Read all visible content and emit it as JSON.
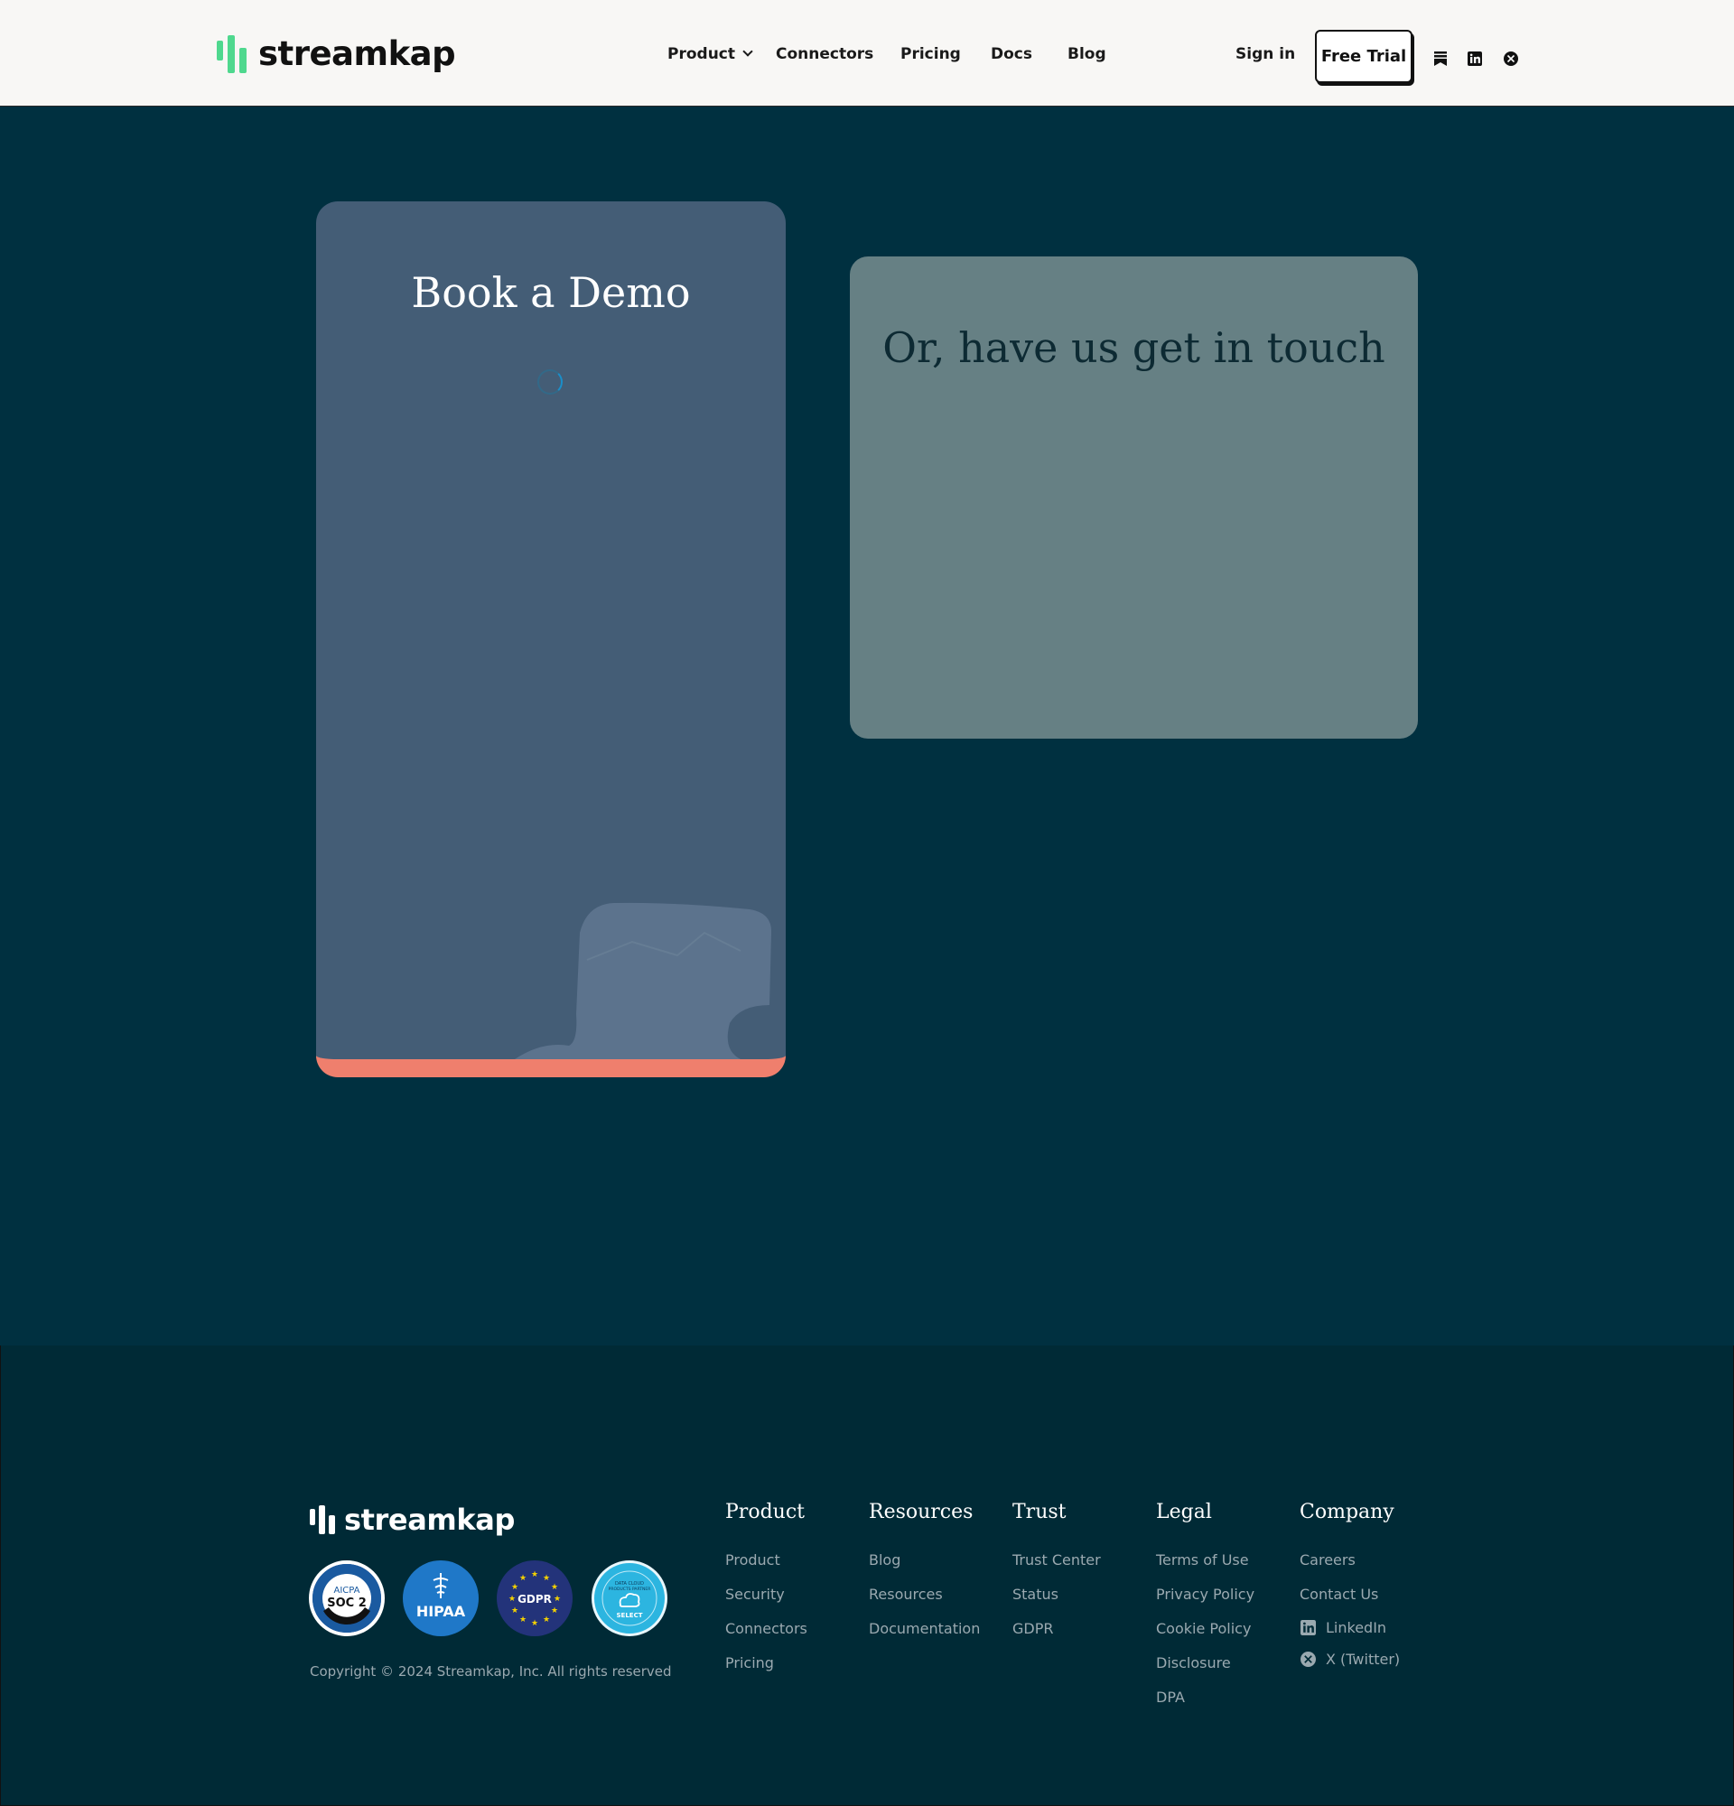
{
  "header": {
    "logo_text": "streamkap",
    "nav": [
      {
        "label": "Product"
      },
      {
        "label": "Connectors"
      },
      {
        "label": "Pricing"
      },
      {
        "label": "Docs"
      },
      {
        "label": "Blog"
      }
    ],
    "sign_in": "Sign in",
    "free_trial": "Free Trial",
    "icons": [
      "substack-icon",
      "linkedin-icon",
      "x-twitter-icon"
    ]
  },
  "demo_card": {
    "title": "Book a Demo",
    "accent_color": "#ef7f6d"
  },
  "contact_card": {
    "title": "Or, have us get in touch"
  },
  "footer": {
    "logo_text": "streamkap",
    "badges": {
      "soc2_top": "AICPA",
      "soc2_main": "SOC 2",
      "hipaa": "HIPAA",
      "gdpr": "GDPR",
      "partner_line1": "DATA CLOUD",
      "partner_line2": "PRODUCTS PARTNER",
      "partner_tier": "SELECT"
    },
    "copyright": "Copyright © 2024 Streamkap, Inc. All rights reserved",
    "columns": [
      {
        "title": "Product",
        "links": [
          "Product",
          "Security",
          "Connectors",
          "Pricing"
        ]
      },
      {
        "title": "Resources",
        "links": [
          "Blog",
          "Resources",
          "Documentation"
        ]
      },
      {
        "title": "Trust",
        "links": [
          "Trust Center",
          "Status",
          "GDPR"
        ]
      },
      {
        "title": "Legal",
        "links": [
          "Terms of Use",
          "Privacy Policy",
          "Cookie Policy",
          "Disclosure",
          "DPA"
        ]
      },
      {
        "title": "Company",
        "links": [
          "Careers",
          "Contact Us"
        ],
        "social": [
          {
            "label": "LinkedIn",
            "icon": "linkedin-icon"
          },
          {
            "label": "X (Twitter)",
            "icon": "x-twitter-icon"
          }
        ]
      }
    ]
  },
  "colors": {
    "page_bg": "#003040",
    "header_bg": "#f8f7f5",
    "logo_green": "#4fd88e",
    "demo_card_bg": "#445d76",
    "contact_card_bg": "#668084",
    "footer_bg": "#002a36"
  }
}
